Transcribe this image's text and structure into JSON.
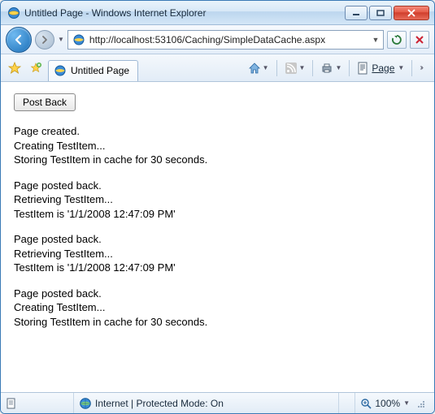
{
  "titlebar": {
    "title": "Untitled Page - Windows Internet Explorer"
  },
  "nav": {
    "url": "http://localhost:53106/Caching/SimpleDataCache.aspx"
  },
  "tabs": {
    "active": "Untitled Page"
  },
  "cmd": {
    "page_label": "Page"
  },
  "content": {
    "button": "Post Back",
    "blocks": [
      {
        "l1": "Page created.",
        "l2": "Creating TestItem...",
        "l3": "Storing TestItem in cache for 30 seconds."
      },
      {
        "l1": "Page posted back.",
        "l2": "Retrieving TestItem...",
        "l3": "TestItem is '1/1/2008 12:47:09 PM'"
      },
      {
        "l1": "Page posted back.",
        "l2": "Retrieving TestItem...",
        "l3": "TestItem is '1/1/2008 12:47:09 PM'"
      },
      {
        "l1": "Page posted back.",
        "l2": "Creating TestItem...",
        "l3": "Storing TestItem in cache for 30 seconds."
      }
    ]
  },
  "status": {
    "zone": "Internet | Protected Mode: On",
    "zoom": "100%"
  }
}
